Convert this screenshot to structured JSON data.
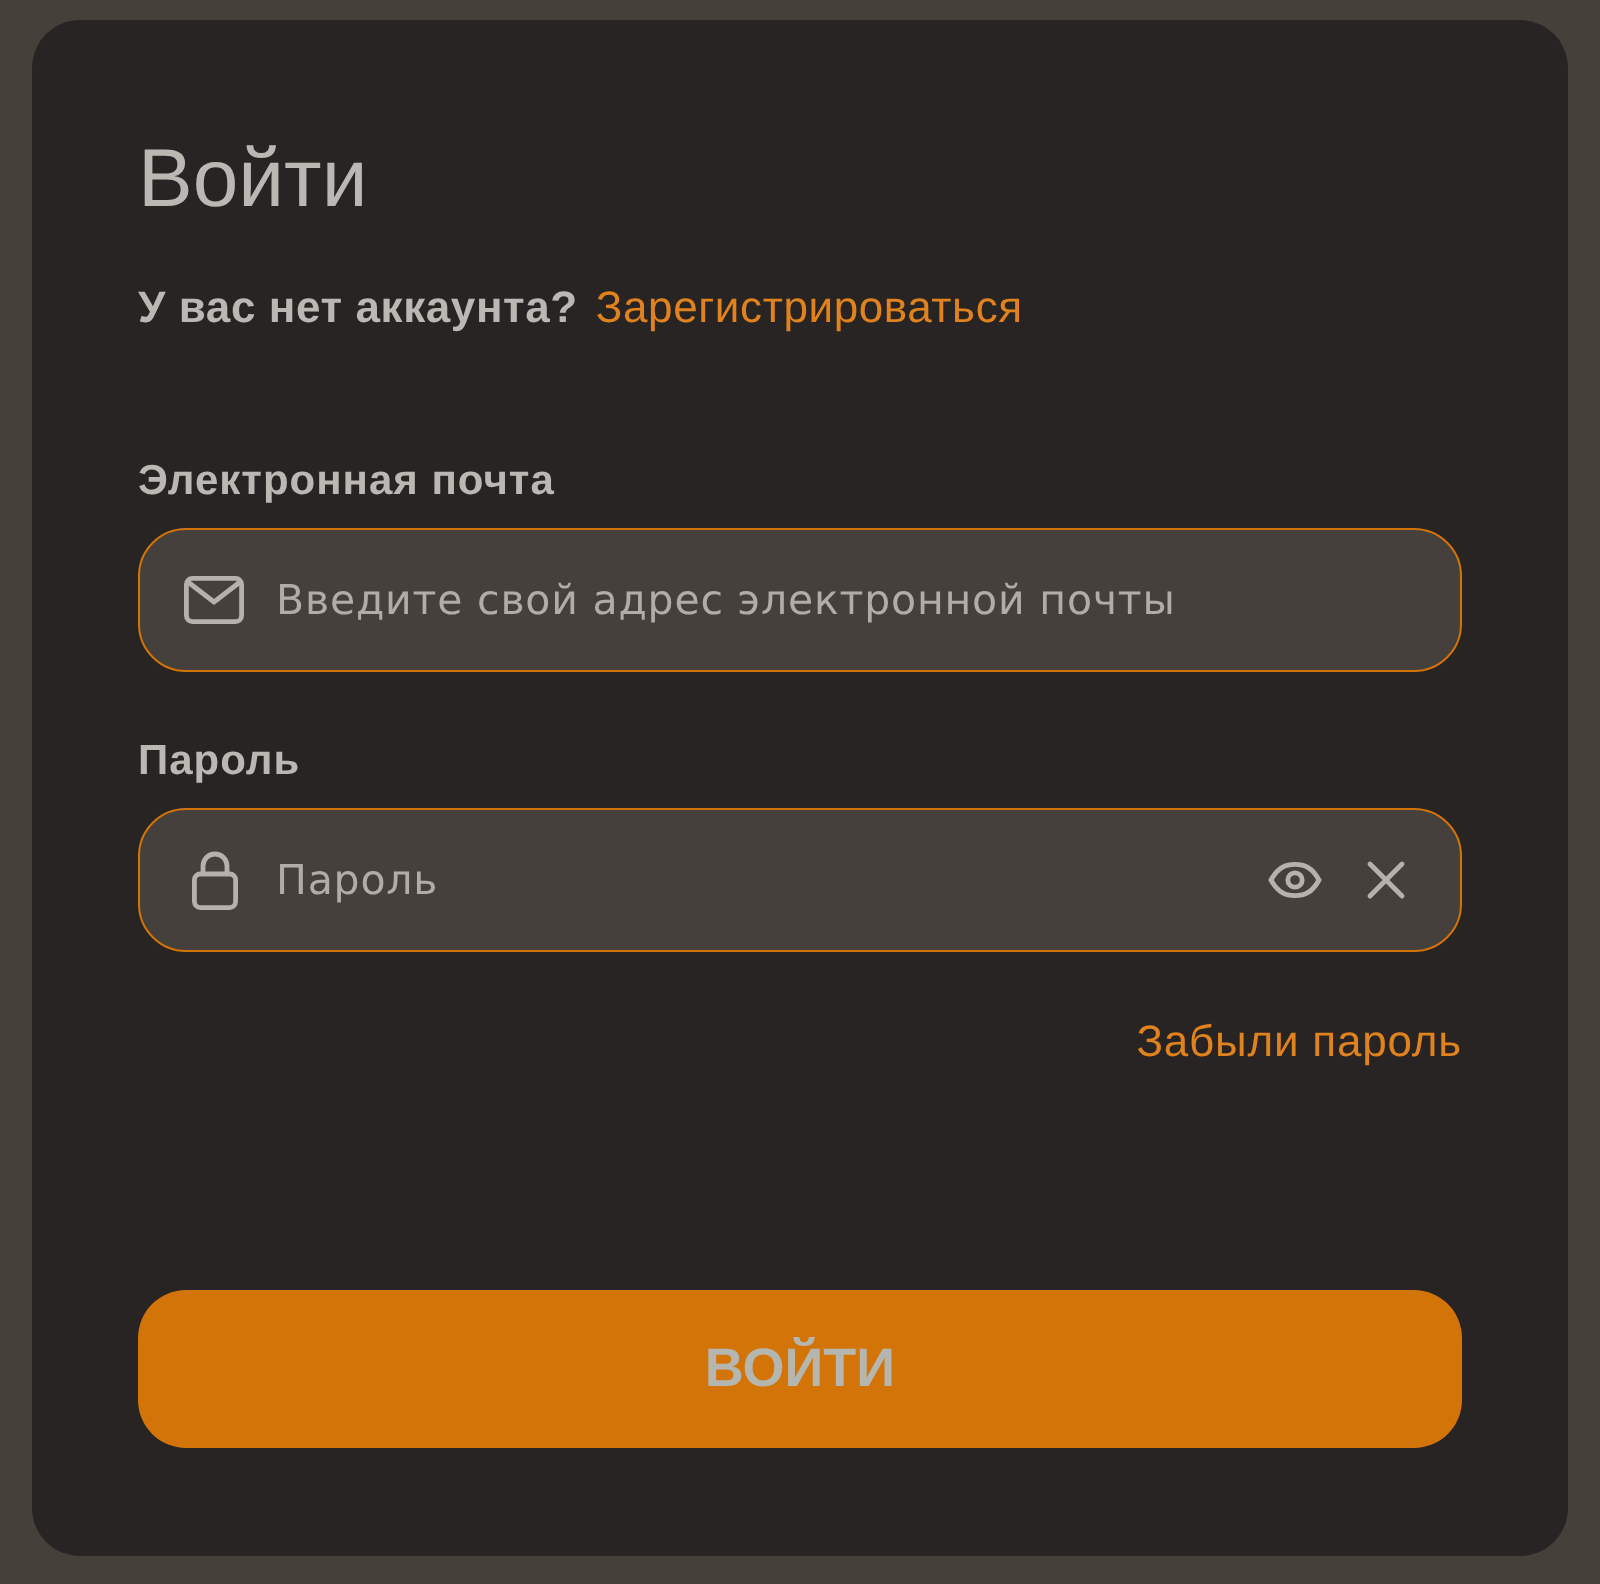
{
  "title": "Войти",
  "signup_prompt": {
    "text": "У вас нет аккаунта?",
    "link": "Зарегистрироваться"
  },
  "fields": [
    {
      "kind": "email",
      "label": "Электронная почта",
      "placeholder": "Введите свой адрес электронной почты"
    },
    {
      "kind": "password",
      "label": "Пароль",
      "placeholder": "Пароль"
    }
  ],
  "forgot_link": "Забыли пароль",
  "submit_button": "ВОЙТИ"
}
